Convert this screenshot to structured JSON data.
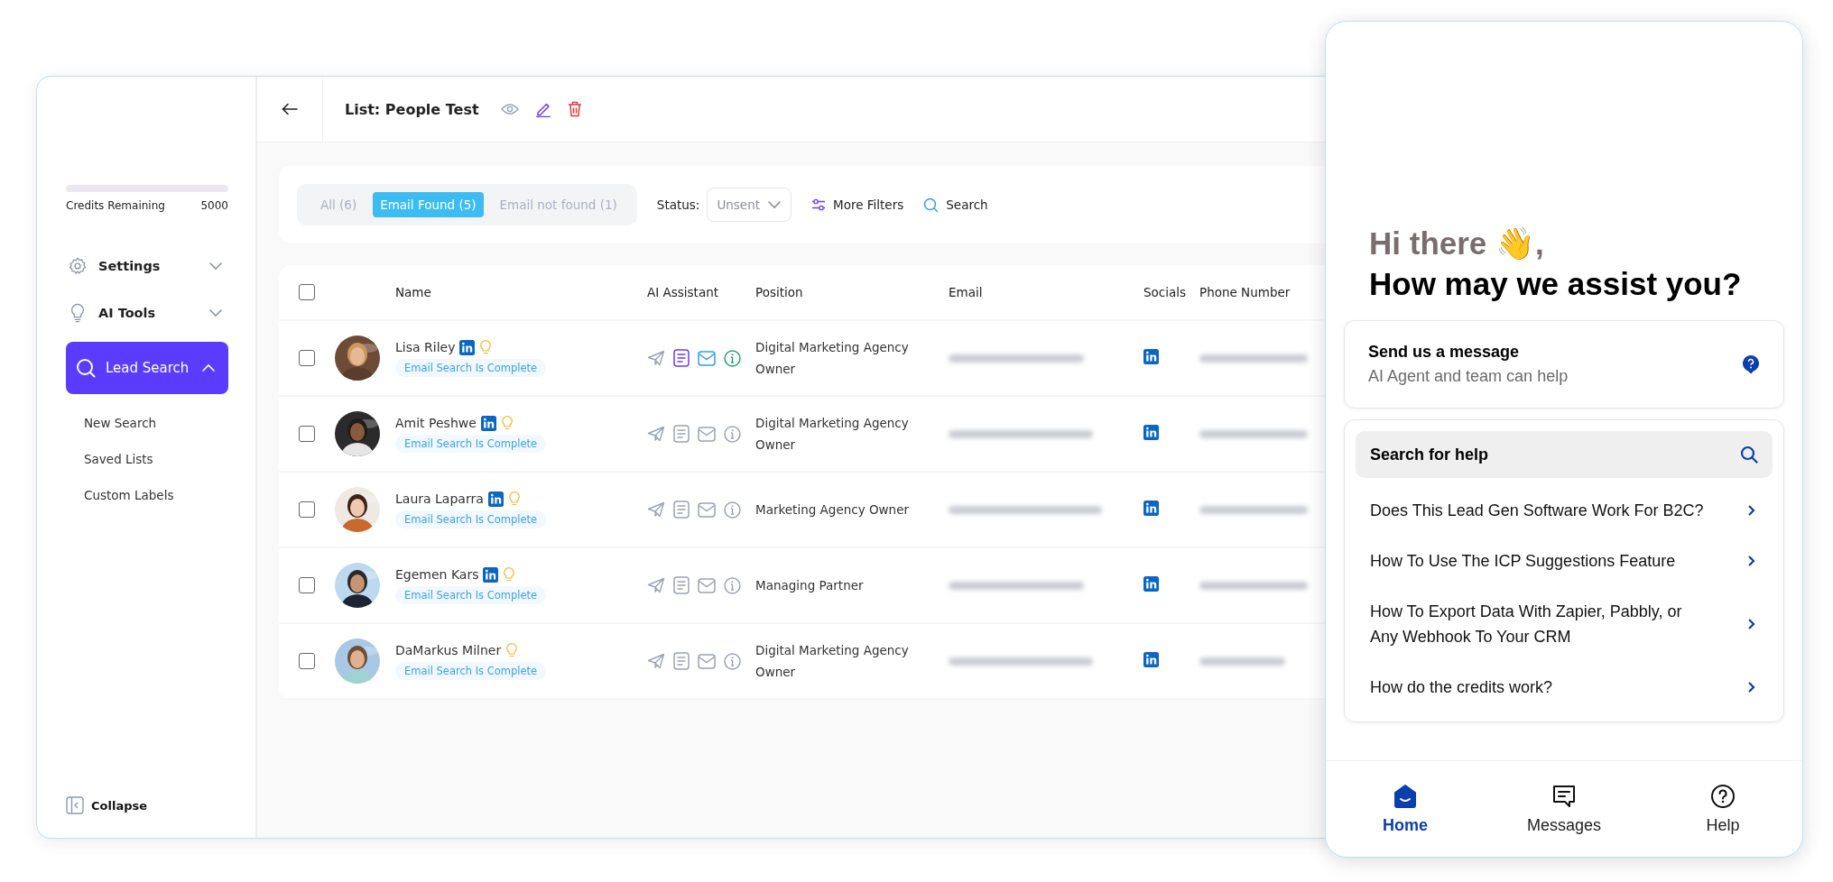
{
  "sidebar": {
    "credits": {
      "label": "Credits Remaining",
      "value": "5000",
      "level": 0
    },
    "nav": [
      {
        "kind": "gear",
        "label": "Settings",
        "expanded": false,
        "selected": false
      },
      {
        "kind": "bulb",
        "label": "AI Tools",
        "expanded": false,
        "selected": false
      },
      {
        "kind": "search",
        "label": "Lead Search",
        "expanded": true,
        "selected": true,
        "children": [
          {
            "label": "New Search"
          },
          {
            "label": "Saved Lists"
          },
          {
            "label": "Custom Labels"
          }
        ]
      }
    ],
    "collapse": "Collapse"
  },
  "header": {
    "title": "List: People Test"
  },
  "filters": {
    "tabs": [
      {
        "label": "All (6)",
        "selected": false
      },
      {
        "label": "Email Found (5)",
        "selected": true
      },
      {
        "label": "Email not found (1)",
        "selected": false
      }
    ],
    "status_label": "Status:",
    "status_value": "Unsent",
    "more_filters": "More Filters",
    "search": "Search"
  },
  "table": {
    "select_all_checked": false,
    "columns": [
      "Name",
      "AI Assistant",
      "Position",
      "Email",
      "Socials",
      "Phone Number"
    ],
    "rows": [
      {
        "name": "Lisa Riley",
        "linkedin": true,
        "status": "Email Search Is Complete",
        "ai_active": true,
        "position": "Digital Marketing Agency Owner",
        "checked": false
      },
      {
        "name": "Amit Peshwe",
        "linkedin": true,
        "status": "Email Search Is Complete",
        "ai_active": false,
        "position": "Digital Marketing Agency Owner",
        "checked": false
      },
      {
        "name": "Laura Laparra",
        "linkedin": true,
        "status": "Email Search Is Complete",
        "ai_active": false,
        "position": "Marketing Agency Owner",
        "checked": false
      },
      {
        "name": "Egemen Kars",
        "linkedin": true,
        "status": "Email Search Is Complete",
        "ai_active": false,
        "position": "Managing Partner",
        "checked": false
      },
      {
        "name": "DaMarkus Milner",
        "linkedin": false,
        "status": "Email Search Is Complete",
        "ai_active": false,
        "position": "Digital Marketing Agency Owner",
        "checked": false
      }
    ]
  },
  "help_widget": {
    "greeting": "Hi there 👋,",
    "title": "How may we assist you?",
    "message_card": {
      "title": "Send us a message",
      "subtitle": "AI Agent and team can help"
    },
    "search": "Search for help",
    "articles": [
      "Does This Lead Gen Software Work For B2C?",
      "How To Use The ICP Suggestions Feature",
      "How To Export Data With Zapier, Pabbly, or Any Webhook To Your CRM",
      "How do the credits work?"
    ],
    "nav": [
      {
        "kind": "home",
        "label": "Home",
        "selected": true
      },
      {
        "kind": "messages",
        "label": "Messages",
        "selected": false
      },
      {
        "kind": "help",
        "label": "Help",
        "selected": false
      }
    ]
  }
}
